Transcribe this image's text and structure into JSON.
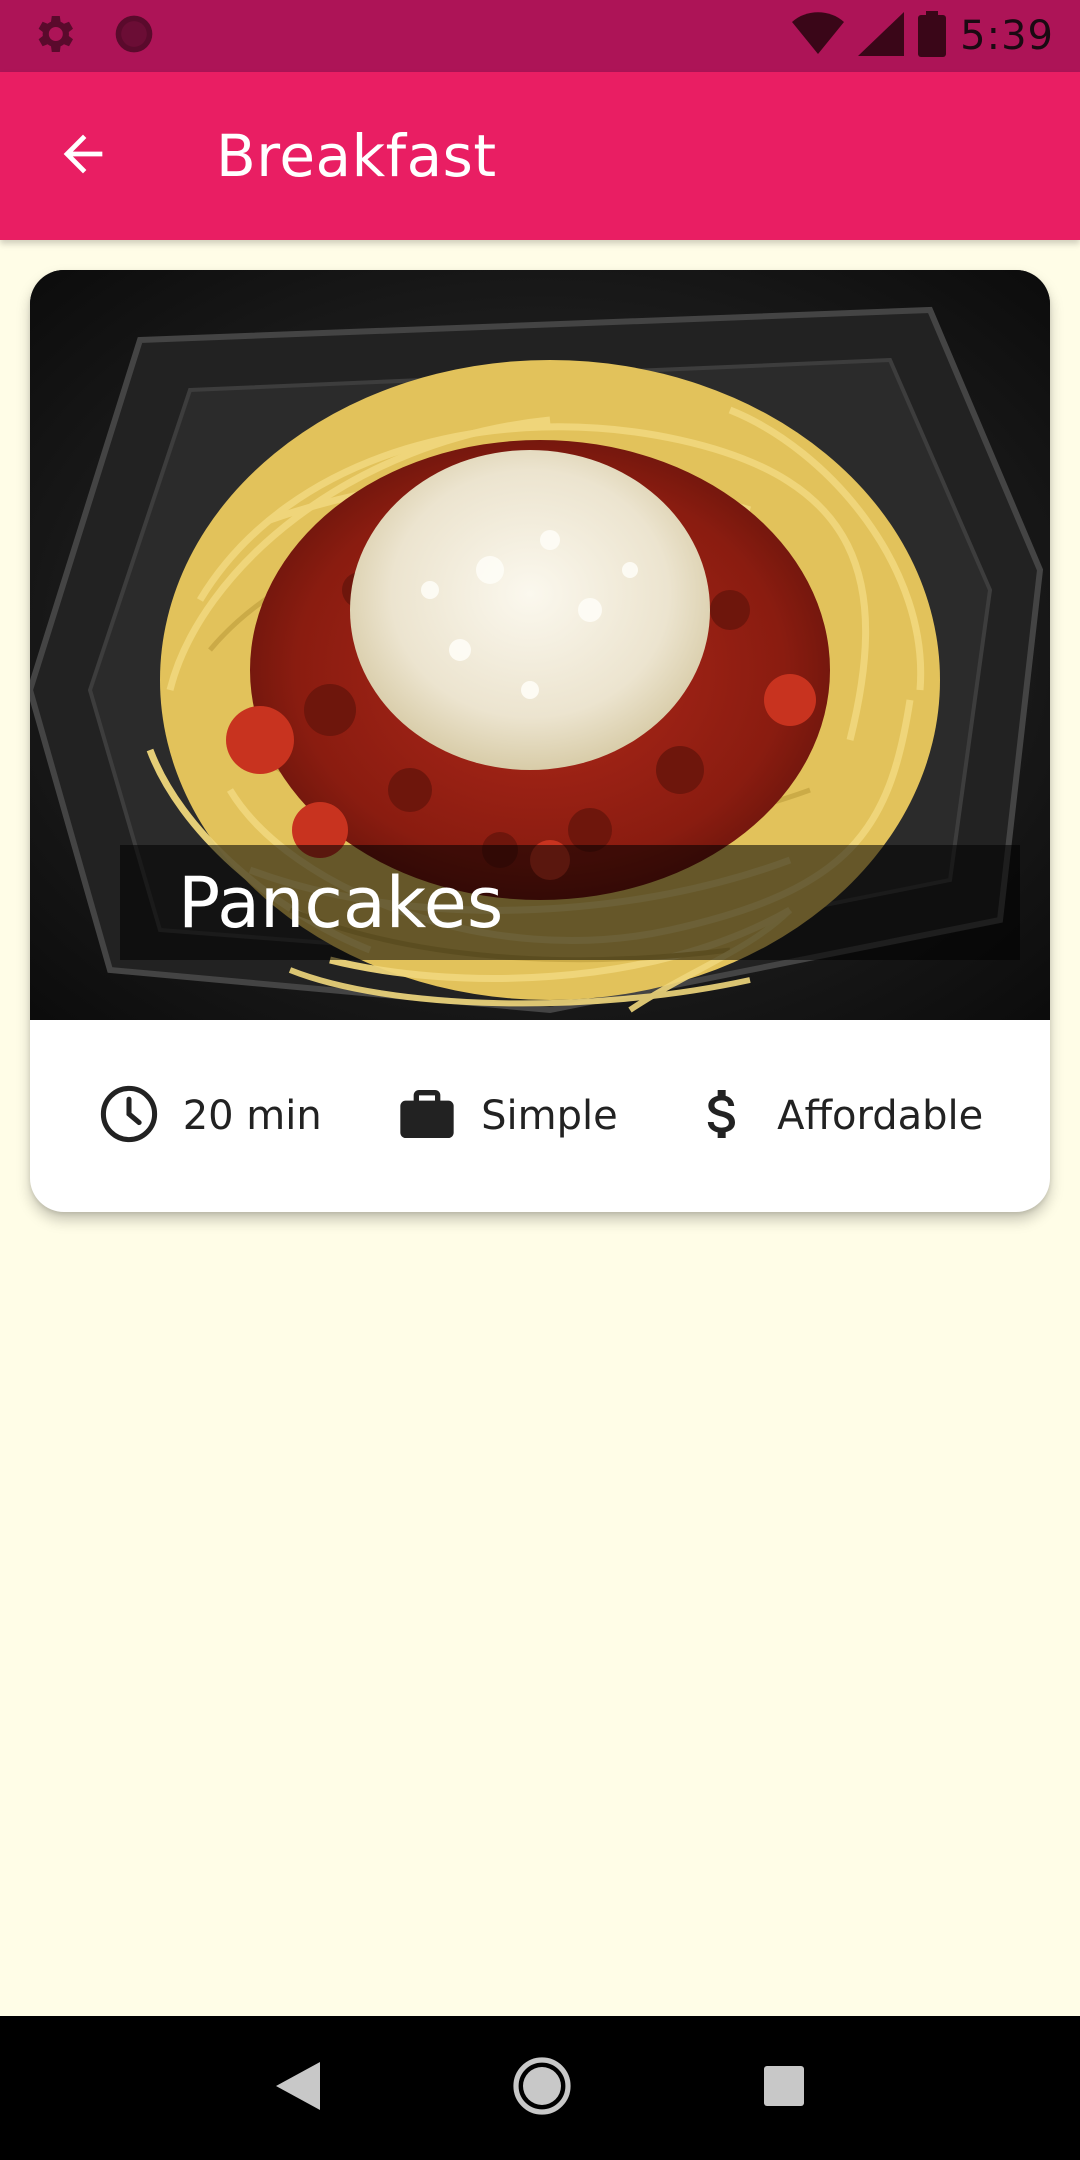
{
  "status_bar": {
    "time": "5:39",
    "left_icons": [
      "settings-icon",
      "record-icon"
    ],
    "right_icons": [
      "wifi-icon",
      "signal-icon",
      "battery-icon"
    ],
    "color": "#ad1457"
  },
  "app_bar": {
    "title": "Breakfast",
    "back_icon": "arrow-back-icon",
    "color": "#e91e63"
  },
  "recipe_card": {
    "title": "Pancakes",
    "image_description": "spaghetti with meat sauce and grated cheese",
    "duration": "20 min",
    "complexity": "Simple",
    "affordability": "Affordable",
    "icons": [
      "clock-icon",
      "briefcase-icon",
      "dollar-icon"
    ]
  },
  "navigation": {
    "icons": [
      "back-triangle-icon",
      "home-circle-icon",
      "recents-square-icon"
    ]
  },
  "colors": {
    "background": "#fffde7",
    "card": "#ffffff"
  }
}
